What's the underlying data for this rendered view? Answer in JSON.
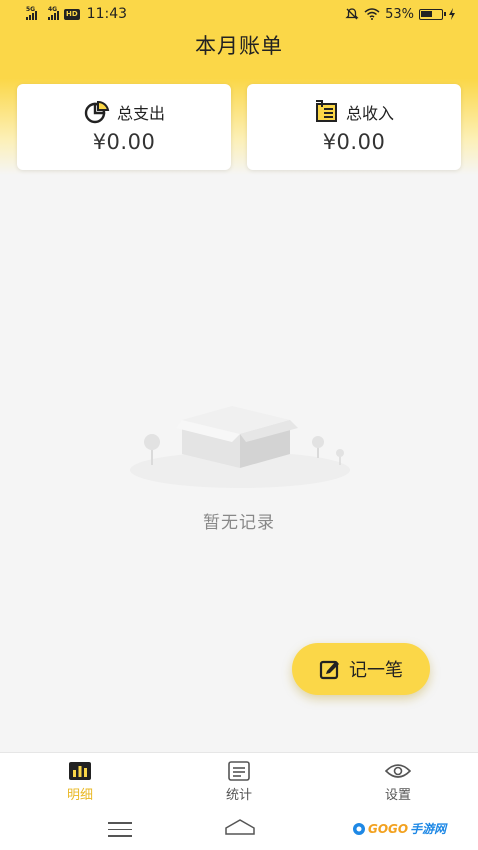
{
  "status_bar": {
    "signal1": "5G",
    "signal2": "4G",
    "hd": "HD",
    "time": "11:43",
    "battery": "53%"
  },
  "header": {
    "title": "本月账单"
  },
  "summary": {
    "expense": {
      "label": "总支出",
      "amount": "¥0.00"
    },
    "income": {
      "label": "总收入",
      "amount": "¥0.00"
    }
  },
  "empty_state": {
    "text": "暂无记录"
  },
  "fab": {
    "label": "记一笔"
  },
  "tabs": [
    {
      "label": "明细",
      "active": true
    },
    {
      "label": "统计",
      "active": false
    },
    {
      "label": "设置",
      "active": false
    }
  ],
  "watermark": {
    "text_a": "GOGO",
    "text_b": "手游网"
  },
  "colors": {
    "accent": "#fbd748",
    "active_tab": "#e9b826",
    "background": "#f5f5f5"
  }
}
